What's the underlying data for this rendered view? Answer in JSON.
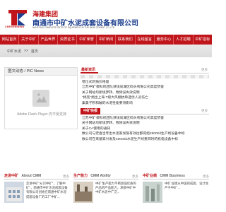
{
  "header": {
    "logo_caption": "CHENGMINING",
    "group_name": "海建集团",
    "company_name": "南通市中矿水泥成套设备有限公司",
    "company_en": "NANTONG COMPLETE SETS OF EQUIPMENT IN THE MINE CEMENT CO.,LTD"
  },
  "nav": {
    "items": [
      "网站首页",
      "关于中矿",
      "产品世界",
      "资质证书",
      "中矿荣誉",
      "中矿新闻",
      "联系我们",
      "在线留言",
      "服务中心",
      "人才招聘",
      "中矿招标"
    ]
  },
  "breadcrumb": {
    "items": [
      "中矿水泥",
      ">>",
      "首页"
    ]
  },
  "left_panel": {
    "title": "图文动态 / PIC News",
    "flash_text": "Adobe Flash Player 仍不受支持"
  },
  "latest": {
    "tab": "最新资讯",
    "more": "更多",
    "items": [
      "错位式的独价格是",
      "江苏中矿'模科机团队获境向湖区码头有限公司高度赞誉",
      "关于网站均新境梦转、致除误失效说明",
      "\"捐克\"捐出上海 T级大风棚抗单选优人员伤亡",
      "集美子积和破的水泥性能要领影响"
    ]
  },
  "news": {
    "tab": "中矿快报",
    "more": "更多",
    "items": [
      "江苏中矿'模科机团队获境向湖区码头有限公司高度赞誉",
      "关于网站均新境梦转、致除误失效说明",
      "关于CA使用的通知",
      "数公司与宏喜当年出水泥家发限有效往都得组2500t/d生产线设备中标",
      "数公司在来基高兴发及4000t/d水泥生产线重同时的机电设备中标"
    ]
  },
  "bottom": {
    "about": {
      "title": "走进中矿",
      "sub": "About CMM",
      "more": "更多",
      "text": "走进中矿\"从识中矿\"，了解中矿\"，南通市中矿水泥成套设备有限公司创始在南通中矿水泥成套设备厂的工厂中矿..."
    },
    "ability": {
      "title": "生产能力",
      "sub": "CMM Ability",
      "more": "更多",
      "text": "中矿'生产能力不断加强优质的产品的产品能力，承接中矿中中矿水泥中广泛..."
    },
    "business": {
      "title": "中矿业绩",
      "sub": "CMM Business",
      "more": "更多",
      "text": "中矿'业绩从中国的成套、设计生产于中矿'..."
    }
  },
  "colors": {
    "brand_red": "#c0161b",
    "brand_blue": "#1d3f8f"
  },
  "icons": [
    "logo-mark-icon",
    "flash-plugin-icon"
  ]
}
